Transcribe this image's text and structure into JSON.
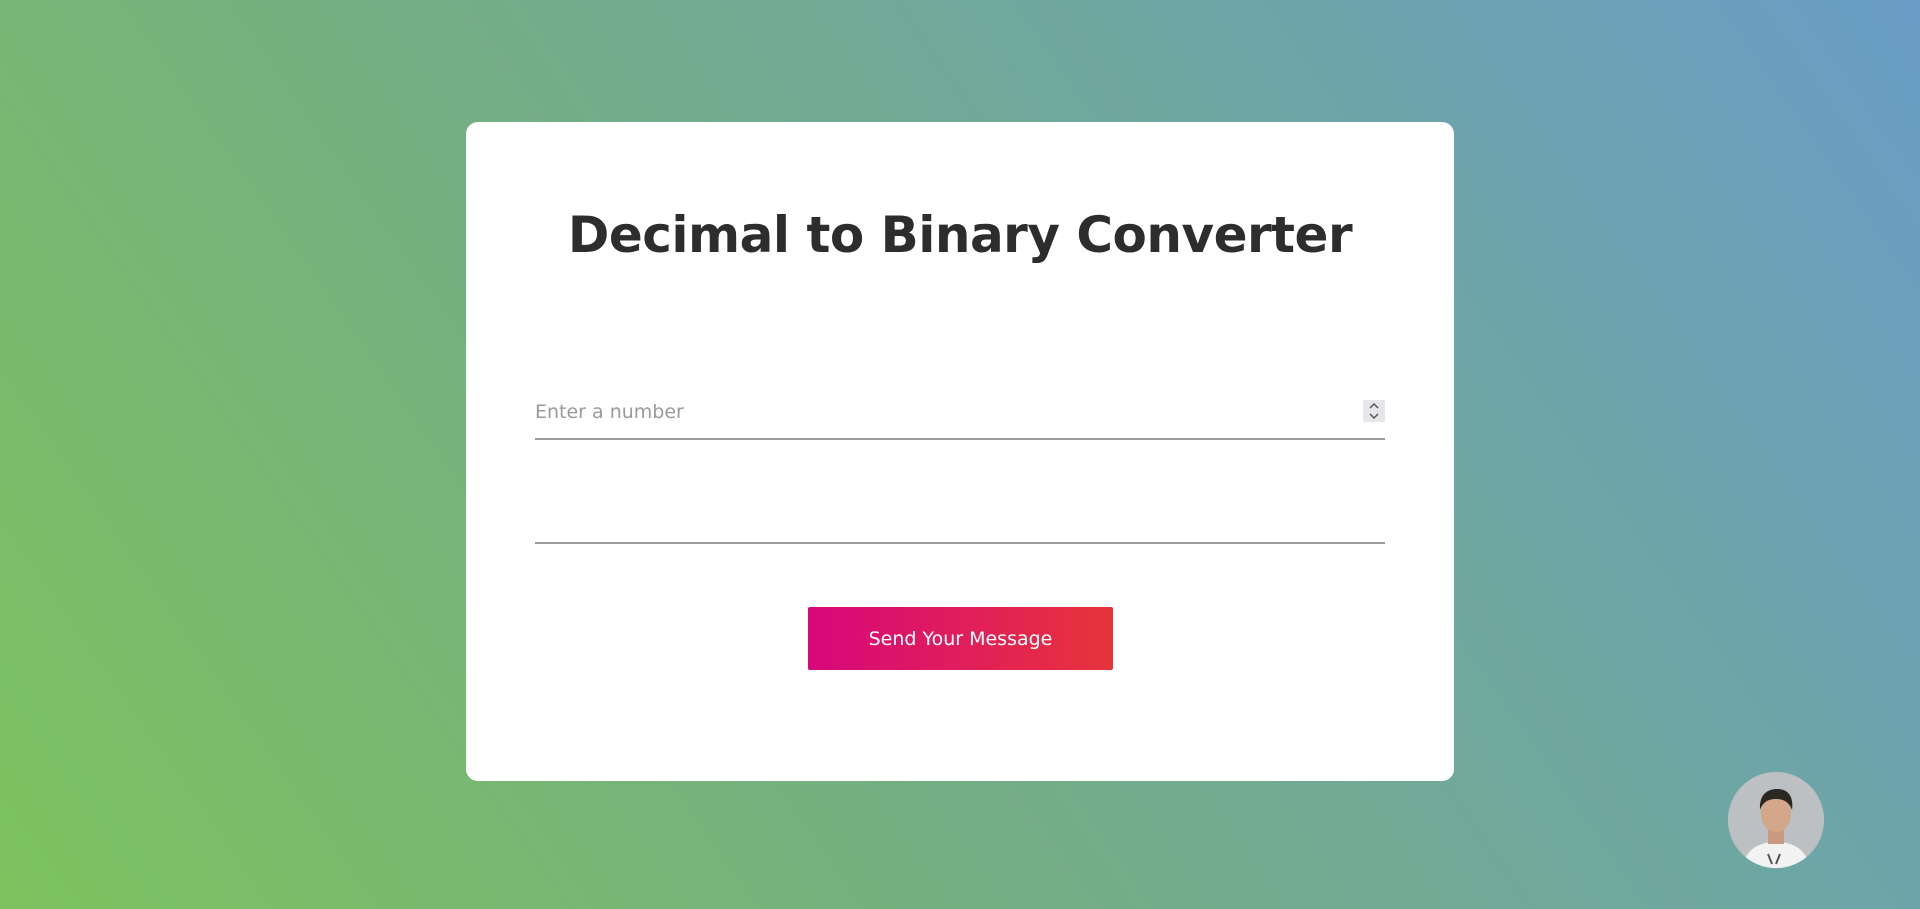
{
  "page": {
    "title": "Decimal to Binary Converter"
  },
  "form": {
    "number_placeholder": "Enter a number",
    "number_value": "",
    "result_value": "",
    "submit_label": "Send Your Message"
  },
  "icons": {
    "spinner_up": "chevron-up-icon",
    "spinner_down": "chevron-down-icon",
    "avatar": "user-avatar"
  },
  "colors": {
    "background_start": "#7cc35e",
    "background_end": "#6a9cc6",
    "title": "#2d2d2d",
    "button_start": "#d8077c",
    "button_end": "#e7343a",
    "underline": "#9b9b9b"
  }
}
